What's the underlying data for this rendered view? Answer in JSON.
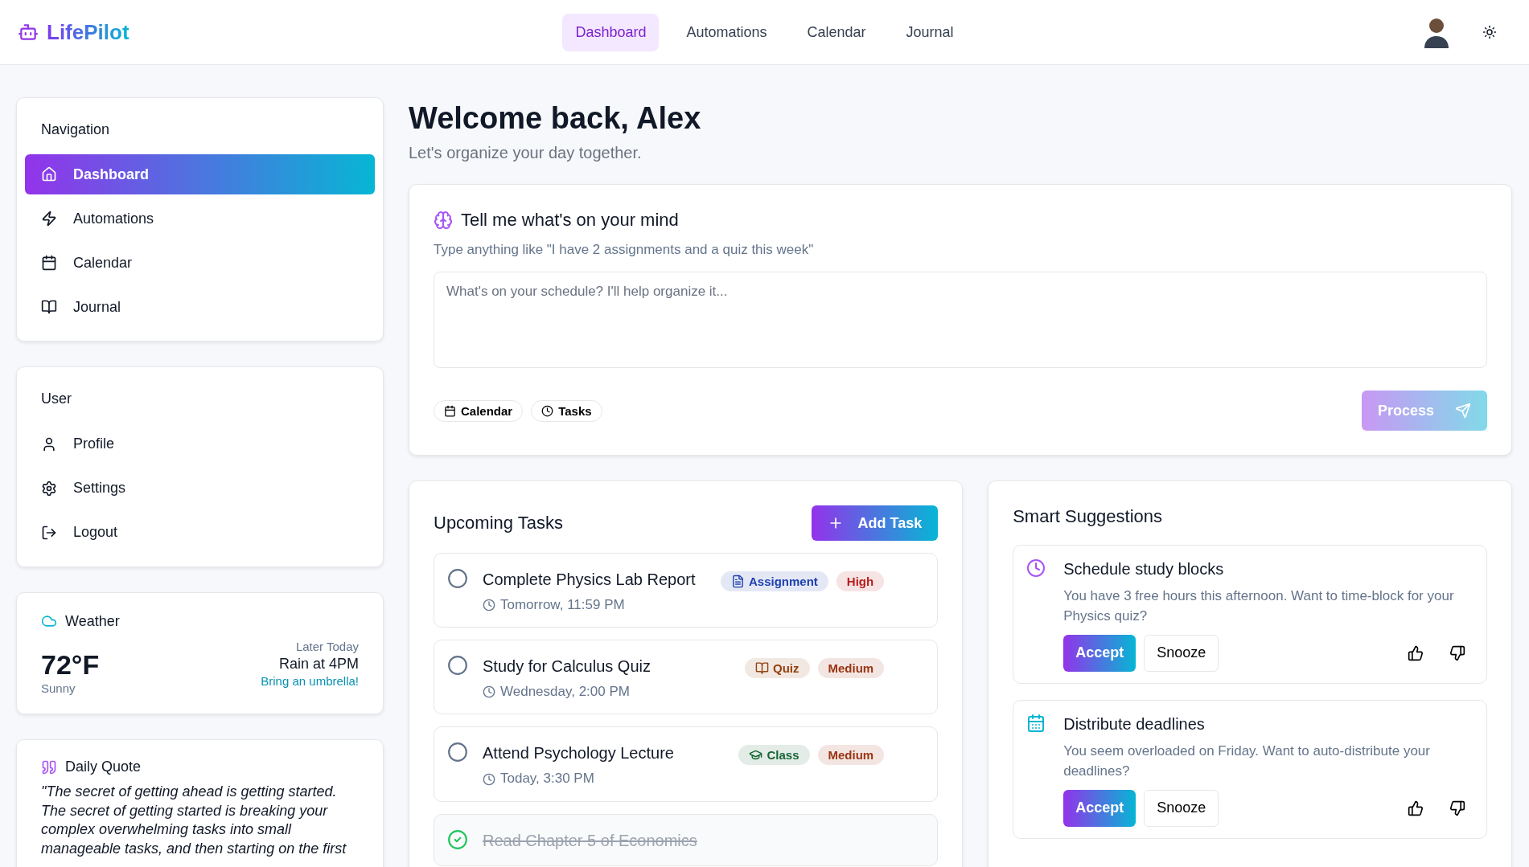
{
  "header": {
    "logo": "LifePilot",
    "tabs": [
      {
        "label": "Dashboard",
        "selected": true
      },
      {
        "label": "Automations",
        "selected": false
      },
      {
        "label": "Calendar",
        "selected": false
      },
      {
        "label": "Journal",
        "selected": false
      }
    ]
  },
  "sidebar": {
    "sections": [
      {
        "title": "Navigation",
        "items": [
          {
            "label": "Dashboard",
            "selected": true
          },
          {
            "label": "Automations",
            "selected": false
          },
          {
            "label": "Calendar",
            "selected": false
          },
          {
            "label": "Journal",
            "selected": false
          }
        ]
      },
      {
        "title": "User",
        "items": [
          {
            "label": "Profile",
            "selected": false
          },
          {
            "label": "Settings",
            "selected": false
          },
          {
            "label": "Logout",
            "selected": false
          }
        ]
      }
    ],
    "weather": {
      "title": "Weather",
      "temperature": "72°F",
      "condition": "Sunny",
      "later_label": "Later Today",
      "forecast": "Rain at 4PM",
      "tip": "Bring an umbrella!"
    },
    "quote": {
      "title": "Daily Quote",
      "text": "\"The secret of getting ahead is getting started. The secret of getting started is breaking your complex overwhelming tasks into small manageable tasks, and then starting on the first"
    }
  },
  "welcome": {
    "title": "Welcome back, Alex",
    "subtitle": "Let's organize your day together."
  },
  "mind": {
    "title": "Tell me what's on your mind",
    "hint": "Type anything like \"I have 2 assignments and a quiz this week\"",
    "placeholder": "What's on your schedule? I'll help organize it...",
    "chips": [
      "Calendar",
      "Tasks"
    ],
    "button": "Process",
    "disabled": true
  },
  "tasks": {
    "title": "Upcoming Tasks",
    "add_button": "Add Task",
    "items": [
      {
        "title": "Complete Physics Lab Report",
        "due": "Tomorrow, 11:59 PM",
        "completed": false,
        "tags": [
          {
            "kind": "category",
            "label": "Assignment",
            "color": "#1e40af"
          },
          {
            "kind": "priority",
            "label": "High",
            "color": "#b91c1c"
          }
        ]
      },
      {
        "title": "Study for Calculus Quiz",
        "due": "Wednesday, 2:00 PM",
        "completed": false,
        "tags": [
          {
            "kind": "category",
            "label": "Quiz",
            "color": "#92400e"
          },
          {
            "kind": "priority",
            "label": "Medium",
            "color": "#9a3412"
          }
        ]
      },
      {
        "title": "Attend Psychology Lecture",
        "due": "Today, 3:30 PM",
        "completed": false,
        "tags": [
          {
            "kind": "category",
            "label": "Class",
            "color": "#166534"
          },
          {
            "kind": "priority",
            "label": "Medium",
            "color": "#9a3412"
          }
        ]
      },
      {
        "title": "Read Chapter 5 of Economics",
        "completed": true
      }
    ]
  },
  "suggestions": {
    "title": "Smart Suggestions",
    "items": [
      {
        "title": "Schedule study blocks",
        "text": "You have 3 free hours this afternoon. Want to time-block for your Physics quiz?",
        "accept": "Accept",
        "snooze": "Snooze"
      },
      {
        "title": "Distribute deadlines",
        "text": "You seem overloaded on Friday. Want to auto-distribute your deadlines?",
        "accept": "Accept",
        "snooze": "Snooze"
      }
    ]
  }
}
